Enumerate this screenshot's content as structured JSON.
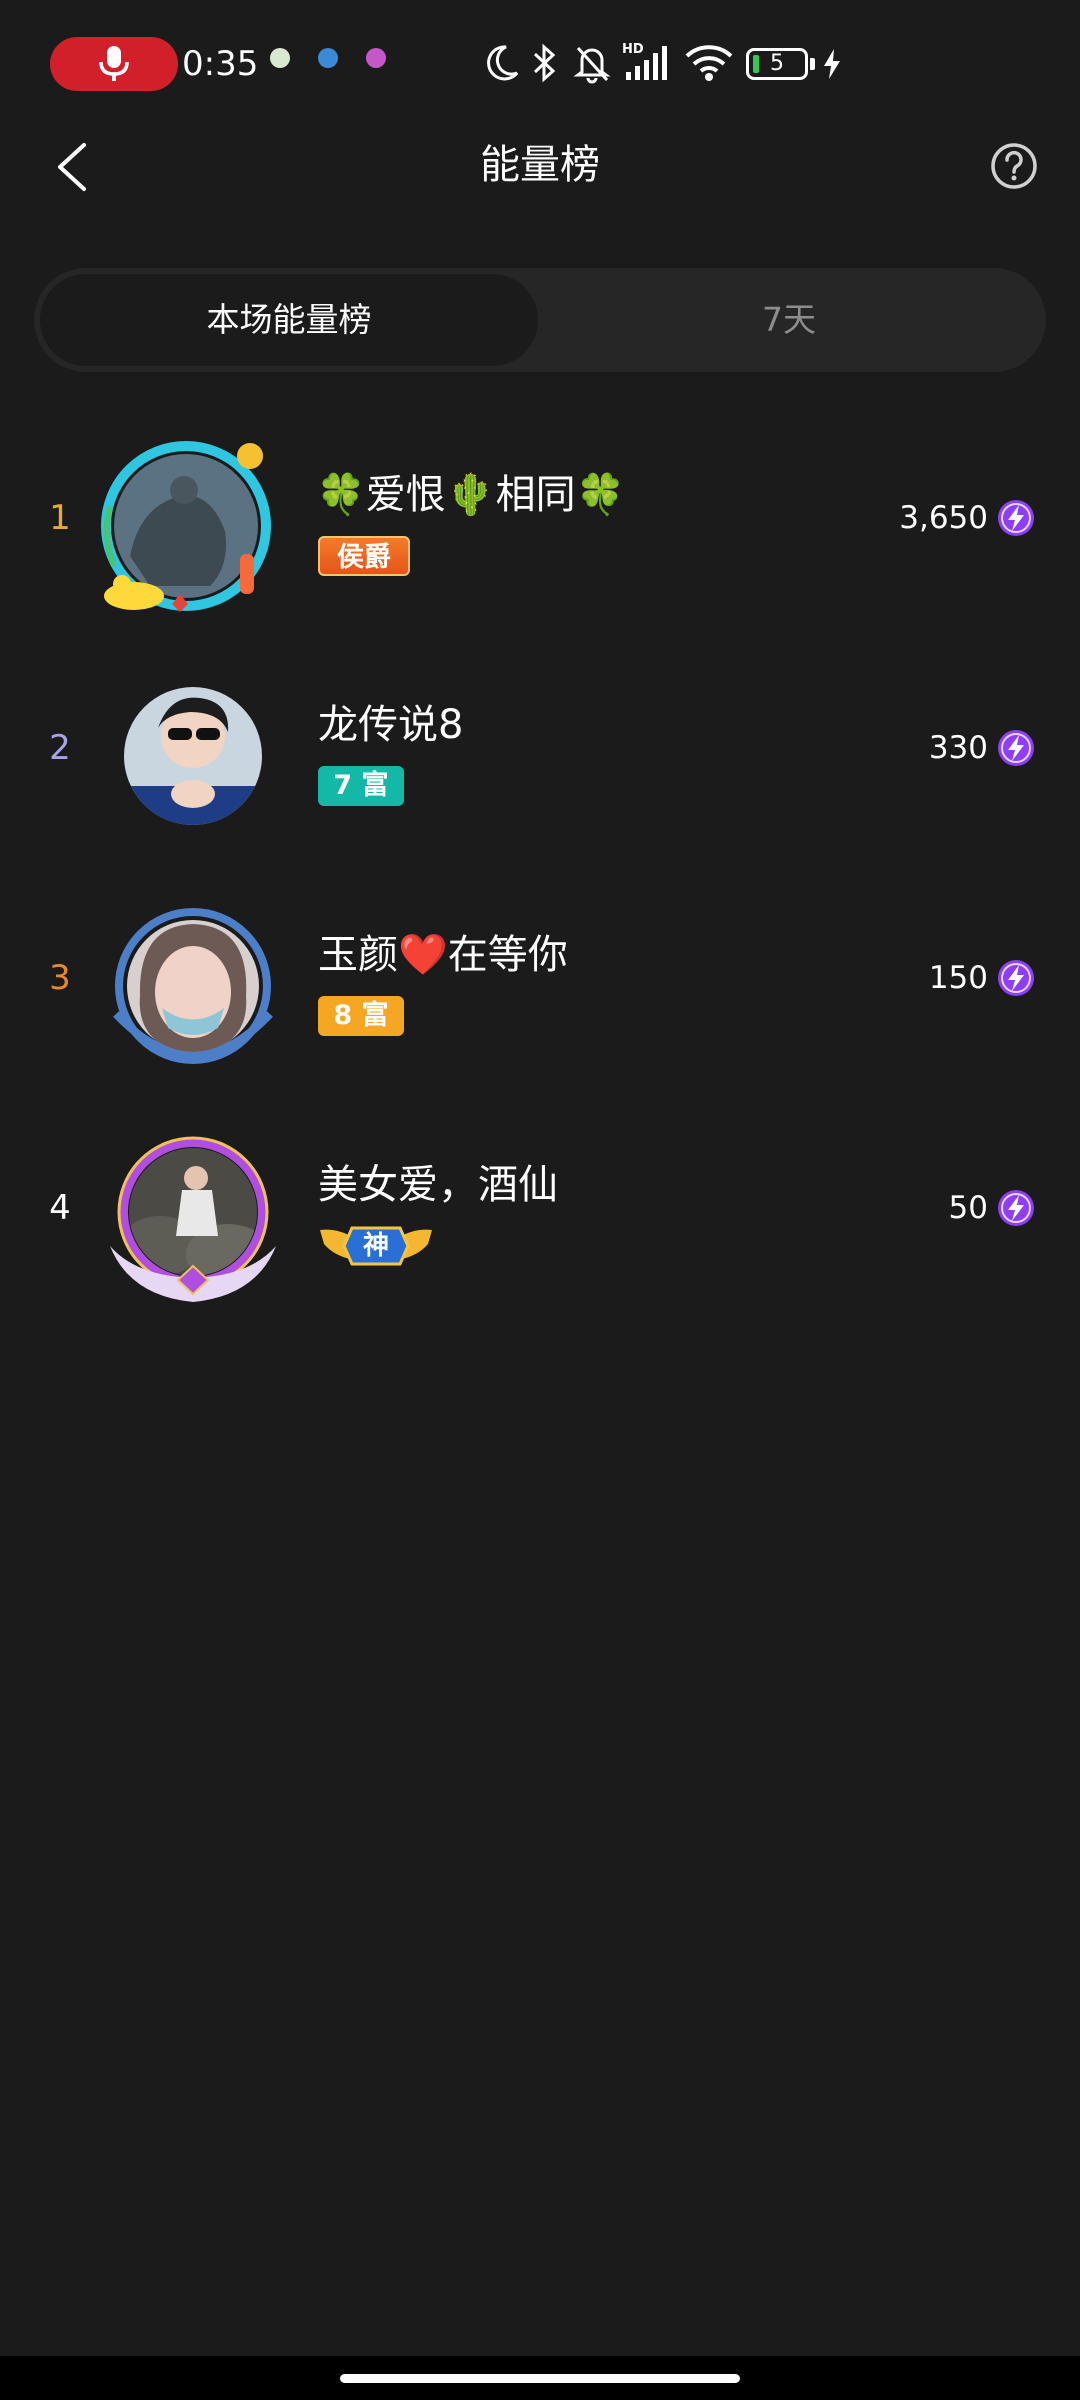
{
  "status_bar": {
    "time": "0:35",
    "battery_level": "5",
    "icons": [
      "microphone-recording-icon",
      "moon-icon",
      "bluetooth-icon",
      "bell-muted-icon",
      "hd-signal-icon",
      "wifi-icon",
      "battery-icon",
      "charging-icon"
    ]
  },
  "header": {
    "title": "能量榜",
    "back_icon": "chevron-left-icon",
    "help_icon": "question-circle-icon"
  },
  "tabs": [
    {
      "label": "本场能量榜",
      "active": true
    },
    {
      "label": "7天",
      "active": false
    }
  ],
  "ranking": [
    {
      "rank": "1",
      "name": "🍀爱恨🌵相同🍀",
      "badge": "侯爵",
      "score": "3,650",
      "rank_color": "#e8a93a",
      "badge_color": "#f06a1d"
    },
    {
      "rank": "2",
      "name": "龙传说8",
      "badge": "7 富",
      "score": "330",
      "rank_color": "#a8a3e6",
      "badge_color": "#14b8a6"
    },
    {
      "rank": "3",
      "name": "玉颜❤️在等你",
      "badge": "8 富",
      "score": "150",
      "rank_color": "#e8892f",
      "badge_color": "#f5a623"
    },
    {
      "rank": "4",
      "name": "美女爱，酒仙",
      "badge": "神",
      "score": "50",
      "rank_color": "#ffffff",
      "badge_color": "#2a6fd6"
    }
  ],
  "colors": {
    "background": "#1b1b1b",
    "tab_track": "#262626",
    "energy_purple": "#8e3ff5"
  }
}
